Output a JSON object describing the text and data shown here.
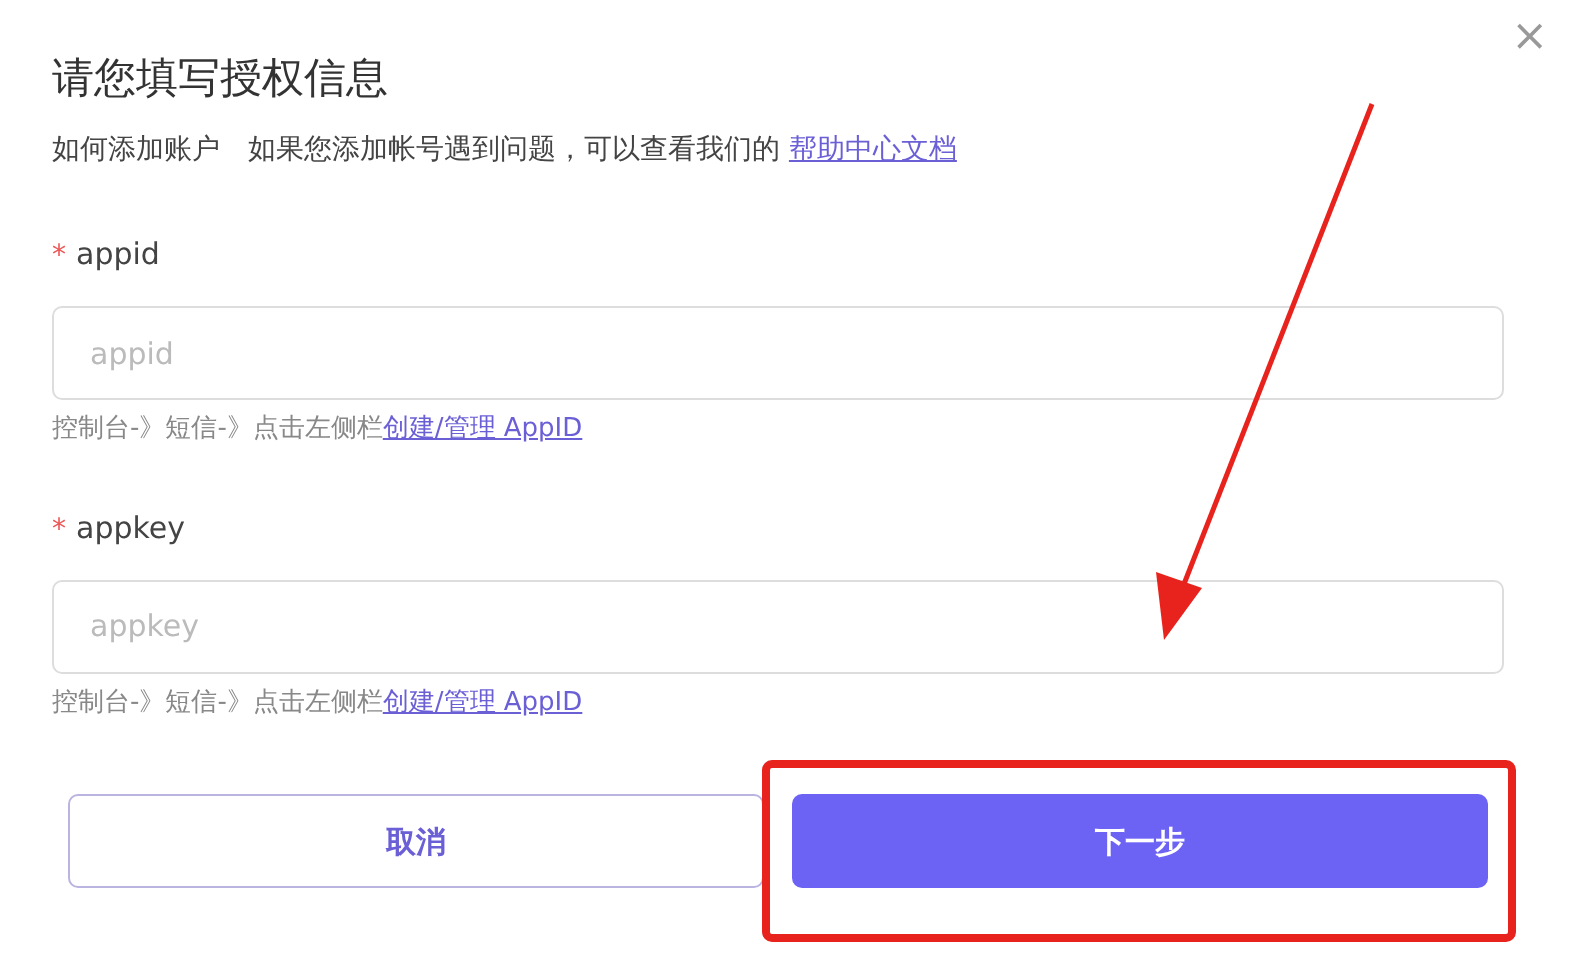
{
  "dialog": {
    "title": "请您填写授权信息",
    "close": "×",
    "intro": {
      "lead": "如何添加账户",
      "text": "如果您添加帐号遇到问题，可以查看我们的",
      "link": "帮助中心文档"
    },
    "fields": [
      {
        "required_mark": "*",
        "label": "appid",
        "placeholder": "appid",
        "hint": "控制台-》短信-》点击左侧栏",
        "hint_link": "创建/管理 AppID"
      },
      {
        "required_mark": "*",
        "label": "appkey",
        "placeholder": "appkey",
        "hint": "控制台-》短信-》点击左侧栏",
        "hint_link": "创建/管理 AppID"
      }
    ],
    "buttons": [
      {
        "label": "取消",
        "kind": "secondary"
      },
      {
        "label": "下一步",
        "kind": "primary"
      }
    ]
  }
}
